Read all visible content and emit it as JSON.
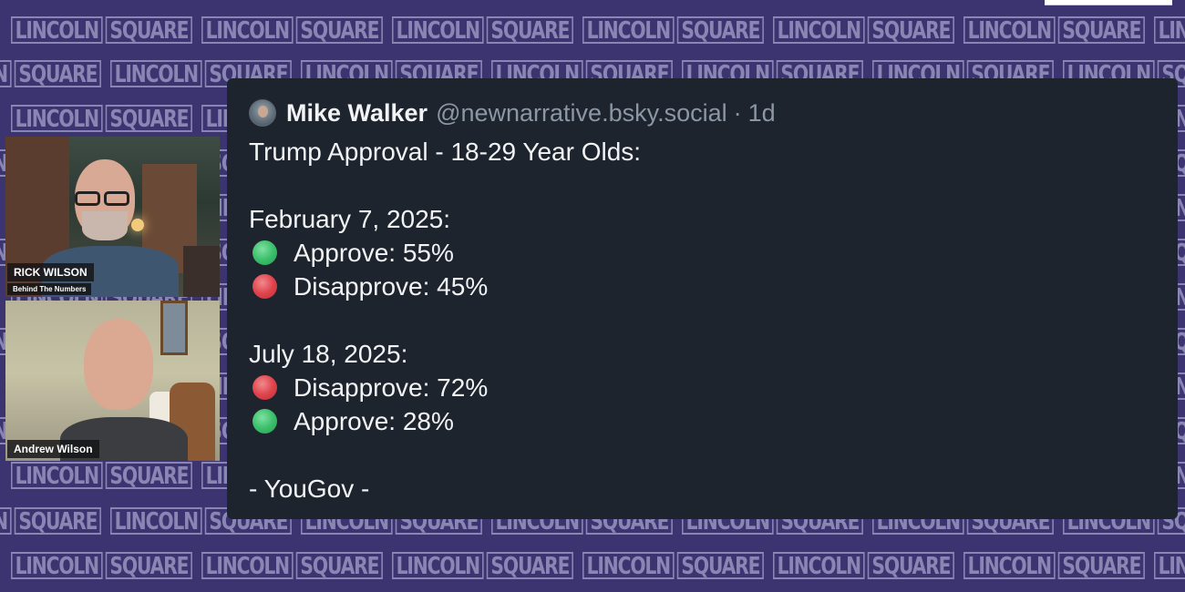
{
  "backdrop": {
    "brand_text": "LINCOLN SQUARE",
    "brand_word_1": "LINCOLN",
    "brand_word_2": "SQUARE",
    "colors": {
      "background": "#3b3470",
      "brand": "#8a86b4"
    }
  },
  "participants": [
    {
      "name": "RICK WILSON",
      "subtitle": "Behind The Numbers"
    },
    {
      "name": "Andrew Wilson"
    }
  ],
  "post": {
    "author_name": "Mike Walker",
    "author_handle": "@newnarrative.bsky.social",
    "separator": "·",
    "time": "1d",
    "title": "Trump Approval - 18-29 Year Olds:",
    "sections": [
      {
        "date": "February 7, 2025:",
        "items": [
          {
            "icon": "green-circle-icon",
            "text": "Approve: 55%"
          },
          {
            "icon": "red-circle-icon",
            "text": "Disapprove: 45%"
          }
        ]
      },
      {
        "date": "July 18, 2025:",
        "items": [
          {
            "icon": "red-circle-icon",
            "text": "Disapprove: 72%"
          },
          {
            "icon": "green-circle-icon",
            "text": "Approve: 28%"
          }
        ]
      }
    ],
    "source": "- YouGov -",
    "colors": {
      "card": "#1e242d",
      "text": "#f1f3f5",
      "muted": "#8b97a4"
    }
  }
}
